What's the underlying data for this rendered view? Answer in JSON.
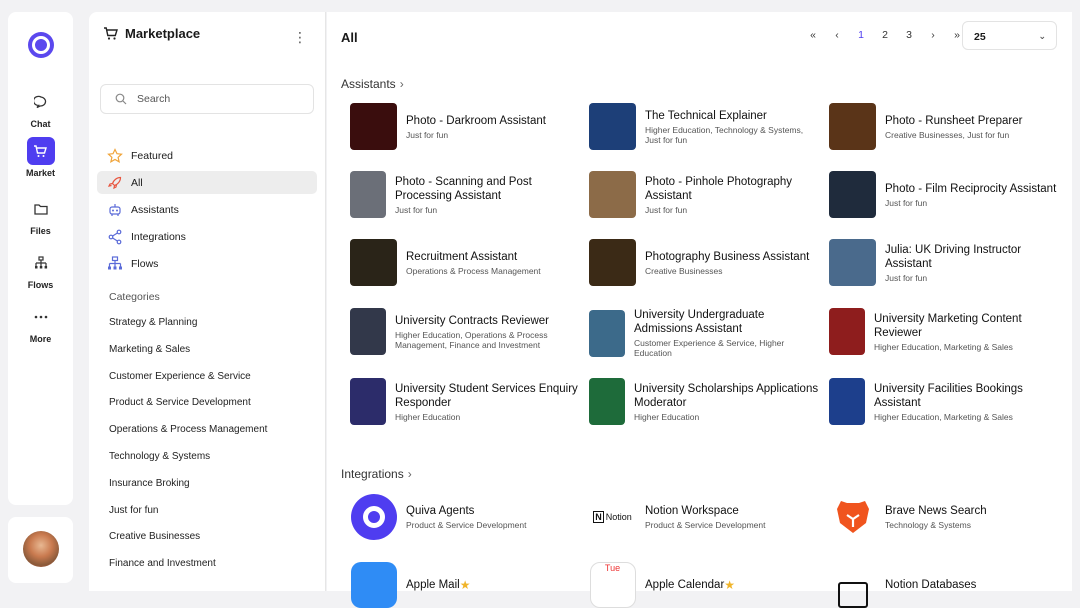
{
  "rail": {
    "items": [
      {
        "label": "Chat",
        "icon": "chat-bubble-icon"
      },
      {
        "label": "Market",
        "icon": "cart-icon",
        "active": true
      },
      {
        "label": "Files",
        "icon": "folder-icon"
      },
      {
        "label": "Flows",
        "icon": "flows-icon"
      },
      {
        "label": "More",
        "icon": "ellipsis-icon"
      }
    ]
  },
  "sidebar": {
    "title": "Marketplace",
    "search_placeholder": "Search",
    "nav": [
      {
        "label": "Featured",
        "icon": "star-icon"
      },
      {
        "label": "All",
        "icon": "rocket-icon",
        "active": true
      },
      {
        "label": "Assistants",
        "icon": "robot-icon"
      },
      {
        "label": "Integrations",
        "icon": "share-nodes-icon"
      },
      {
        "label": "Flows",
        "icon": "flows-icon"
      }
    ],
    "categories_title": "Categories",
    "categories": [
      "Strategy & Planning",
      "Marketing & Sales",
      "Customer Experience & Service",
      "Product & Service Development",
      "Operations & Process Management",
      "Technology & Systems",
      "Insurance Broking",
      "Just for fun",
      "Creative Businesses",
      "Finance and Investment"
    ]
  },
  "main": {
    "title": "All",
    "pager": {
      "pages": [
        "1",
        "2",
        "3"
      ],
      "current": "1",
      "page_size": "25"
    },
    "assistants_title": "Assistants",
    "integrations_title": "Integrations",
    "assistants": [
      {
        "name": "Photo - Darkroom Assistant",
        "tags": "Just for fun",
        "color": "#3a0d0d"
      },
      {
        "name": "The Technical Explainer",
        "tags": "Higher Education, Technology & Systems, Just for fun",
        "color": "#1d3f78"
      },
      {
        "name": "Photo - Runsheet Preparer",
        "tags": "Creative Businesses, Just for fun",
        "color": "#5a3418"
      },
      {
        "name": "Photo - Scanning and Post Processing Assistant",
        "tags": "Just for fun",
        "color": "#6b6f78",
        "small": true
      },
      {
        "name": "Photo - Pinhole Photography Assistant",
        "tags": "Just for fun",
        "color": "#8c6b48"
      },
      {
        "name": "Photo - Film Reciprocity Assistant",
        "tags": "Just for fun",
        "color": "#1f2b3c"
      },
      {
        "name": "Recruitment Assistant",
        "tags": "Operations & Process Management",
        "color": "#2a2418"
      },
      {
        "name": "Photography Business Assistant",
        "tags": "Creative Businesses",
        "color": "#3b2a16"
      },
      {
        "name": "Julia: UK Driving Instructor Assistant",
        "tags": "Just for fun",
        "color": "#4a6a8c"
      },
      {
        "name": "University Contracts Reviewer",
        "tags": "Higher Education, Operations & Process Management, Finance and Investment",
        "color": "#32384a",
        "small": true
      },
      {
        "name": "University Undergraduate Admissions Assistant",
        "tags": "Customer Experience & Service, Higher Education",
        "color": "#3c6a8a",
        "small": true
      },
      {
        "name": "University Marketing Content Reviewer",
        "tags": "Higher Education, Marketing & Sales",
        "color": "#8e1d1d",
        "small": true
      },
      {
        "name": "University Student Services Enquiry Responder",
        "tags": "Higher Education",
        "color": "#2c2c6a",
        "small": true
      },
      {
        "name": "University Scholarships Applications Moderator",
        "tags": "Higher Education",
        "color": "#1e6b3a",
        "small": true
      },
      {
        "name": "University Facilities Bookings Assistant",
        "tags": "Higher Education, Marketing & Sales",
        "color": "#1d3f8c",
        "small": true
      }
    ],
    "integrations": [
      {
        "name": "Quiva Agents",
        "tags": "Product & Service Development",
        "icon": "quiva-logo-icon",
        "color": "#4f3df0"
      },
      {
        "name": "Notion Workspace",
        "tags": "Product & Service Development",
        "icon": "notion-logo-icon",
        "logo_text": "Notion",
        "color": "#111111"
      },
      {
        "name": "Brave News Search",
        "tags": "Technology & Systems",
        "icon": "brave-lion-icon",
        "color": "#f0541e"
      },
      {
        "name": "Apple Mail",
        "icon": "mail-app-icon",
        "color": "#2f8cf5"
      },
      {
        "name": "Apple Calendar",
        "icon": "calendar-app-icon",
        "color": "#ffffff",
        "logo_text": "Tue"
      },
      {
        "name": "Notion Databases",
        "icon": "notion-db-icon",
        "color": "#111111"
      }
    ]
  }
}
